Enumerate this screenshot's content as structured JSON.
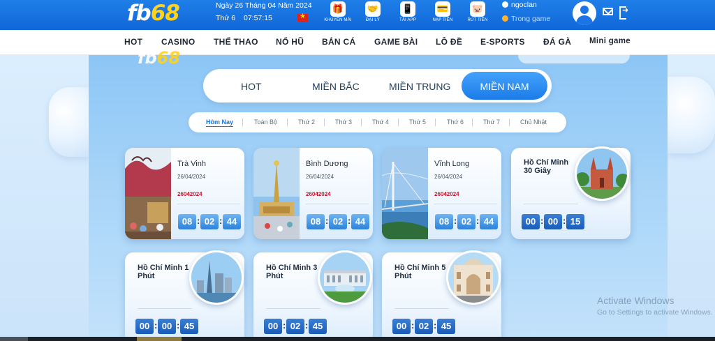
{
  "header": {
    "logo_main": "fb",
    "logo_accent": "68",
    "date": "Ngày 26 Tháng 04 Năm 2024",
    "weekday": "Thứ 6",
    "time": "07:57:15",
    "quick_links": [
      {
        "label": "KHUYẾN MÃI",
        "icon": "gift-icon"
      },
      {
        "label": "ĐẠI LÝ",
        "icon": "handshake-icon"
      },
      {
        "label": "TẢI APP",
        "icon": "phone-icon"
      },
      {
        "label": "NẠP TIỀN",
        "icon": "wallet-icon"
      },
      {
        "label": "RÚT TIỀN",
        "icon": "piggy-bank-icon"
      }
    ],
    "username": "ngoclan",
    "balance_label": "Trong game"
  },
  "nav": {
    "items": [
      "HOT",
      "CASINO",
      "THỂ THAO",
      "NỔ HŨ",
      "BẮN CÁ",
      "GAME BÀI",
      "LÔ ĐỀ",
      "E-SPORTS",
      "ĐÁ GÀ",
      "Mini game"
    ]
  },
  "panel": {
    "logo_main": "fb",
    "logo_accent": "68"
  },
  "regions": {
    "tabs": [
      "HOT",
      "MIỀN BẮC",
      "MIỀN TRUNG",
      "MIỀN NAM"
    ],
    "active": "MIỀN NAM"
  },
  "days": {
    "tabs": [
      "Hôm Nay",
      "Toàn Bộ",
      "Thứ 2",
      "Thứ 3",
      "Thứ 4",
      "Thứ 5",
      "Thứ 6",
      "Thứ 7",
      "Chủ Nhật"
    ],
    "active": "Hôm Nay"
  },
  "lotteries": [
    {
      "name": "Trà Vinh",
      "date": "26/04/2024",
      "code": "26042024",
      "hh": "08",
      "mm": "02",
      "ss": "44"
    },
    {
      "name": "Bình Dương",
      "date": "26/04/2024",
      "code": "26042024",
      "hh": "08",
      "mm": "02",
      "ss": "44"
    },
    {
      "name": "Vĩnh Long",
      "date": "26/04/2024",
      "code": "26042024",
      "hh": "08",
      "mm": "02",
      "ss": "44"
    },
    {
      "name": "Hồ Chí Minh 30 Giây",
      "hh": "00",
      "mm": "00",
      "ss": "15"
    },
    {
      "name": "Hồ Chí Minh 1 Phút",
      "hh": "00",
      "mm": "00",
      "ss": "45"
    },
    {
      "name": "Hồ Chí Minh 3 Phút",
      "hh": "00",
      "mm": "02",
      "ss": "45"
    },
    {
      "name": "Hồ Chí Minh 5 Phút",
      "hh": "00",
      "mm": "02",
      "ss": "45"
    }
  ],
  "watermark": {
    "title": "Activate Windows",
    "subtitle": "Go to Settings to activate Windows."
  },
  "colors": {
    "header_blue": "#1674e3",
    "accent_yellow": "#ffd21f",
    "active_tab_blue": "#1b7ce9",
    "code_red": "#d1162c"
  }
}
